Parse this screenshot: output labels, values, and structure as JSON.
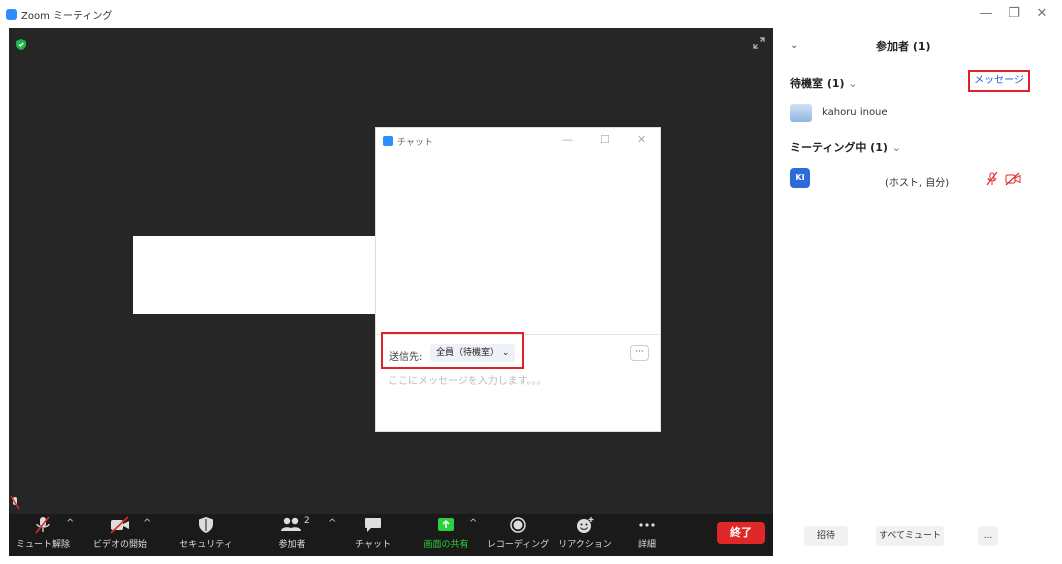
{
  "titlebar": {
    "title": "Zoom ミーティング",
    "controls": [
      "—",
      "❐",
      "✕"
    ]
  },
  "chat": {
    "title": "チャット",
    "window_controls": [
      "—",
      "☐",
      "✕"
    ],
    "to_label": "送信先:",
    "recipient": "全員（待機室）",
    "more": "···",
    "placeholder": "ここにメッセージを入力します。。。"
  },
  "toolbar": {
    "items": [
      {
        "label": "ミュート解除",
        "icon": "muted-mic-icon"
      },
      {
        "label": "ビデオの開始",
        "icon": "video-off-icon"
      },
      {
        "label": "セキュリティ",
        "icon": "shield-icon"
      },
      {
        "label": "参加者",
        "icon": "participants-icon",
        "count": "2"
      },
      {
        "label": "チャット",
        "icon": "chat-bubble-icon"
      },
      {
        "label": "画面の共有",
        "icon": "share-screen-icon"
      },
      {
        "label": "レコーディング",
        "icon": "record-icon"
      },
      {
        "label": "リアクション",
        "icon": "reaction-icon"
      },
      {
        "label": "詳細",
        "icon": "more-icon"
      }
    ],
    "end_label": "終了",
    "share_color": "#2ad13a",
    "end_color": "#e02828"
  },
  "panel": {
    "title": "参加者 (1)",
    "waiting_room": "待機室 (1)",
    "message_button": "メッセージ",
    "waiting_participant": "kahoru inoue",
    "in_meeting": "ミーティング中 (1)",
    "host_initials": "KI",
    "host_role": "(ホスト, 自分)",
    "invite": "招待",
    "mute_all": "すべてミュート",
    "more": "..."
  },
  "colors": {
    "accent": "#2d8cff",
    "highlight_border": "#e0202a",
    "video_bg": "#262626"
  }
}
